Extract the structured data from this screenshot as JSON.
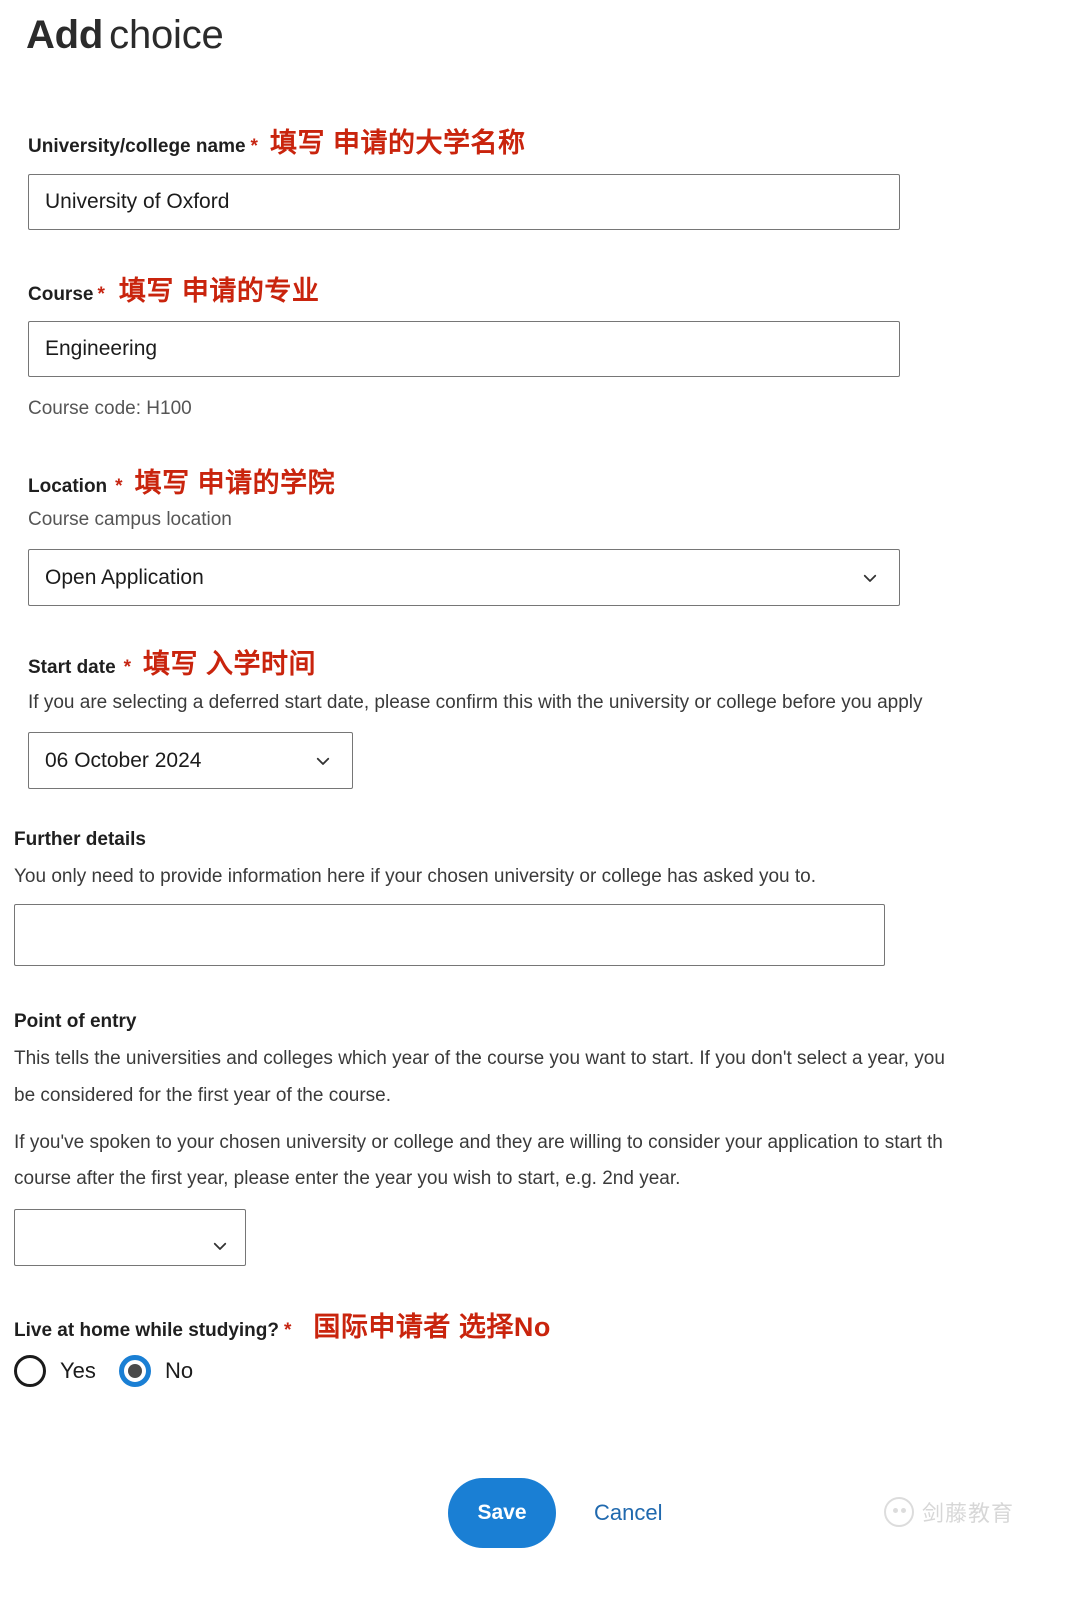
{
  "header": {
    "title_strong": "Add",
    "title_light": "choice"
  },
  "form": {
    "university": {
      "label": "University/college name",
      "required_marker": "*",
      "annotation_cn": "填写 申请的大学名称",
      "value": "University of Oxford",
      "placeholder": ""
    },
    "course": {
      "label": "Course",
      "required_marker": "*",
      "annotation_cn": "填写 申请的专业",
      "value": "Engineering",
      "placeholder": "",
      "course_code": "Course code: H100"
    },
    "location": {
      "label": "Location",
      "required_marker": "*",
      "annotation_cn": "填写 申请的学院",
      "sublabel": "Course campus location",
      "value": "Open Application",
      "options": [
        "Open Application"
      ]
    },
    "start_date": {
      "label": "Start date",
      "required_marker": "*",
      "annotation_cn": "填写 入学时间",
      "hint": "If you are selecting a deferred start date, please confirm this with the university or college before you apply",
      "value": "06 October 2024",
      "options": [
        "06 October 2024"
      ]
    },
    "further_details": {
      "label": "Further details",
      "hint": "You only need to provide information here if your chosen university or college has asked you to.",
      "value": "",
      "placeholder": ""
    },
    "point_of_entry": {
      "label": "Point of entry",
      "paragraph_1_line_1": "This tells the universities and colleges which year of the course you want to start. If you don't select a year, you",
      "paragraph_1_line_2": "be considered for the first year of the course.",
      "paragraph_2_line_1": "If you've spoken to your chosen university or college and they are willing to consider your application to start th",
      "paragraph_2_line_2": "course after the first year, please enter the year you wish to start, e.g. 2nd year.",
      "value": "",
      "options": [
        ""
      ]
    },
    "live_at_home": {
      "label": "Live at home while studying?",
      "required_marker": "*",
      "annotation_cn": "国际申请者 选择No",
      "option_yes": "Yes",
      "option_no": "No",
      "selected": "No"
    }
  },
  "actions": {
    "save_label": "Save",
    "cancel_label": "Cancel"
  },
  "watermark": {
    "text": "剑藤教育"
  },
  "colors": {
    "accent_blue": "#1a7fd4",
    "link_blue": "#2069ae",
    "annotation_red": "#c9240d",
    "required_red": "#c62512",
    "border_grey": "#767676",
    "text_dark": "#1f1f1f"
  }
}
